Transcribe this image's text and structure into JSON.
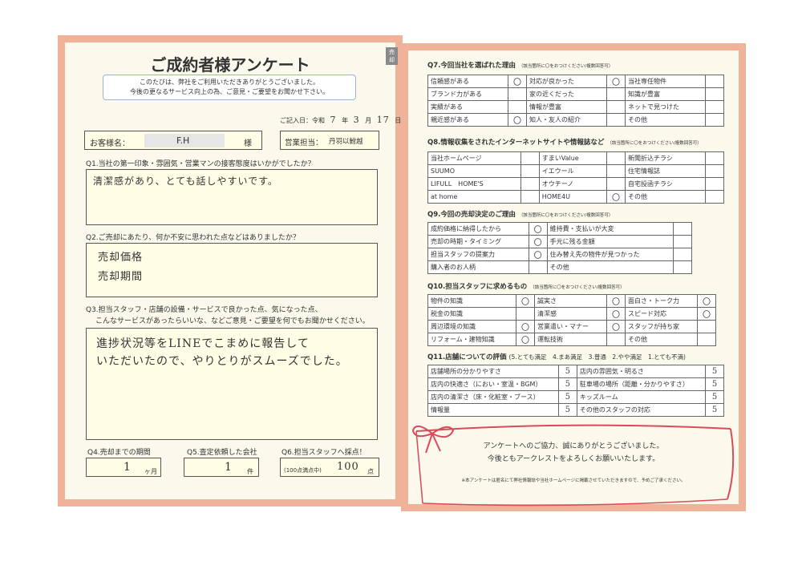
{
  "left": {
    "title": "ご成約者様アンケート",
    "tag": "売却",
    "intro_1": "このたびは、弊社をご利用いただきありがとうございました。",
    "intro_2": "今後の更なるサービス向上の為、ご意見・ご要望をお聞かせ下さい。",
    "date_label": "ご記入日：令和",
    "date_year": "7",
    "date_year_unit": "年",
    "date_month": "3",
    "date_month_unit": "月",
    "date_day": "17",
    "date_day_unit": "日",
    "customer_label": "お客様名：",
    "customer_name": "F.H",
    "customer_suffix": "様",
    "staff_label": "営業担当：",
    "staff_name": "丹羽以鮒越",
    "q1": "Q1.当社の第一印象・雰囲気・営業マンの接客態度はいかがでしたか？",
    "a1": "清潔感があり、とても話しやすいです。",
    "q2": "Q2.ご売却にあたり、何か不安に思われた点などはありましたか？",
    "a2_1": "売却価格",
    "a2_2": "売却期間",
    "q3_1": "Q3.担当スタッフ・店舗の設備・サービスで良かった点、気になった点、",
    "q3_2": "こんなサービスがあったらいいな、などご意見・ご要望を何でもお聞かせください。",
    "a3_1": "進捗状況等をLINEでこまめに報告して",
    "a3_2": "いただいたので、やりとりがスムーズでした。",
    "q4": "Q4.売却までの期間",
    "a4": "1",
    "a4_unit": "ヶ月",
    "q5": "Q5.査定依頼した会社",
    "a5": "1",
    "a5_unit": "件",
    "q6": "Q6.担当スタッフへ採点！",
    "a6_prefix": "(100点満点中)",
    "a6": "100",
    "a6_unit": "点"
  },
  "right": {
    "q7": "Q7.今回当社を選ばれた理由",
    "q7_note": "（該当箇所に〇をおつけください/複数回答可）",
    "q7_rows": [
      [
        "信頼感がある",
        "〇",
        "対応が良かった",
        "〇",
        "当社専任物件",
        ""
      ],
      [
        "ブランド力がある",
        "",
        "家の近くだった",
        "",
        "知識が豊富",
        ""
      ],
      [
        "実績がある",
        "",
        "情報が豊富",
        "",
        "ネットで見つけた",
        ""
      ],
      [
        "親近感がある",
        "〇",
        "知人・友人の紹介",
        "",
        "その他",
        ""
      ]
    ],
    "q8": "Q8.情報収集をされたインターネットサイトや情報誌など",
    "q8_note": "（該当箇所に〇をおつけください/複数回答可）",
    "q8_rows": [
      [
        "当社ホームページ",
        "",
        "すまいValue",
        "",
        "新聞折込チラシ",
        ""
      ],
      [
        "SUUMO",
        "",
        "イエウール",
        "",
        "住宅情報誌",
        ""
      ],
      [
        "LIFULL　HOME'S",
        "",
        "オウチーノ",
        "",
        "自宅投函チラシ",
        ""
      ],
      [
        "at home",
        "",
        "HOME4U",
        "〇",
        "その他",
        ""
      ]
    ],
    "q9": "Q9.今回の売却決定のご理由",
    "q9_note": "（該当箇所に〇をおつけください/複数回答可）",
    "q9_rows": [
      [
        "成約価格に納得したから",
        "〇",
        "維持費・支払いが大変",
        ""
      ],
      [
        "売却の時期・タイミング",
        "〇",
        "手元に残る金額",
        ""
      ],
      [
        "担当スタッフの提案力",
        "〇",
        "住み替え先の物件が見つかった",
        ""
      ],
      [
        "購入者のお人柄",
        "",
        "その他",
        ""
      ]
    ],
    "q10": "Q10.担当スタッフに求めるもの",
    "q10_note": "（該当箇所に〇をおつけください/複数回答可）",
    "q10_rows": [
      [
        "物件の知識",
        "〇",
        "誠実さ",
        "〇",
        "面白さ・トーク力",
        "〇"
      ],
      [
        "税金の知識",
        "",
        "清潔感",
        "〇",
        "スピード対応",
        "〇"
      ],
      [
        "周辺環境の知識",
        "〇",
        "営業遣い・マナー",
        "〇",
        "スタッフが持ち家",
        ""
      ],
      [
        "リフォーム・建物知識",
        "〇",
        "運転技術",
        "",
        "その他",
        ""
      ]
    ],
    "q11": "Q11.店舗についての評価",
    "q11_scale": "(5.とても満足　4.まあ満足　3.普通　2.やや満足　1.とても不満)",
    "q11_rows": [
      [
        "店舗場所の分かりやすさ",
        "5",
        "店内の雰囲気・明るさ",
        "5"
      ],
      [
        "店内の快適さ（におい・室温・BGM）",
        "5",
        "駐車場の場所（距離・分かりやすさ）",
        "5"
      ],
      [
        "店内の清潔さ（床・化粧室・ブース）",
        "5",
        "キッズルーム",
        "5"
      ],
      [
        "情報量",
        "5",
        "その他のスタッフの対応",
        "5"
      ]
    ],
    "thanks_1": "アンケートへのご協力、誠にありがとうございました。",
    "thanks_2": "今後ともアークレストをよろしくお願いいたします。",
    "disclaimer": "※本アンケートは匿名にて弊社情報誌や当社ホームページに掲載させていただきますので、予めご了承ください。"
  },
  "colors": {
    "border": "#f0b39a",
    "ribbon": "#d94a5a",
    "answer_bg": "#fffde6",
    "intro_border": "#9ab4d8"
  }
}
